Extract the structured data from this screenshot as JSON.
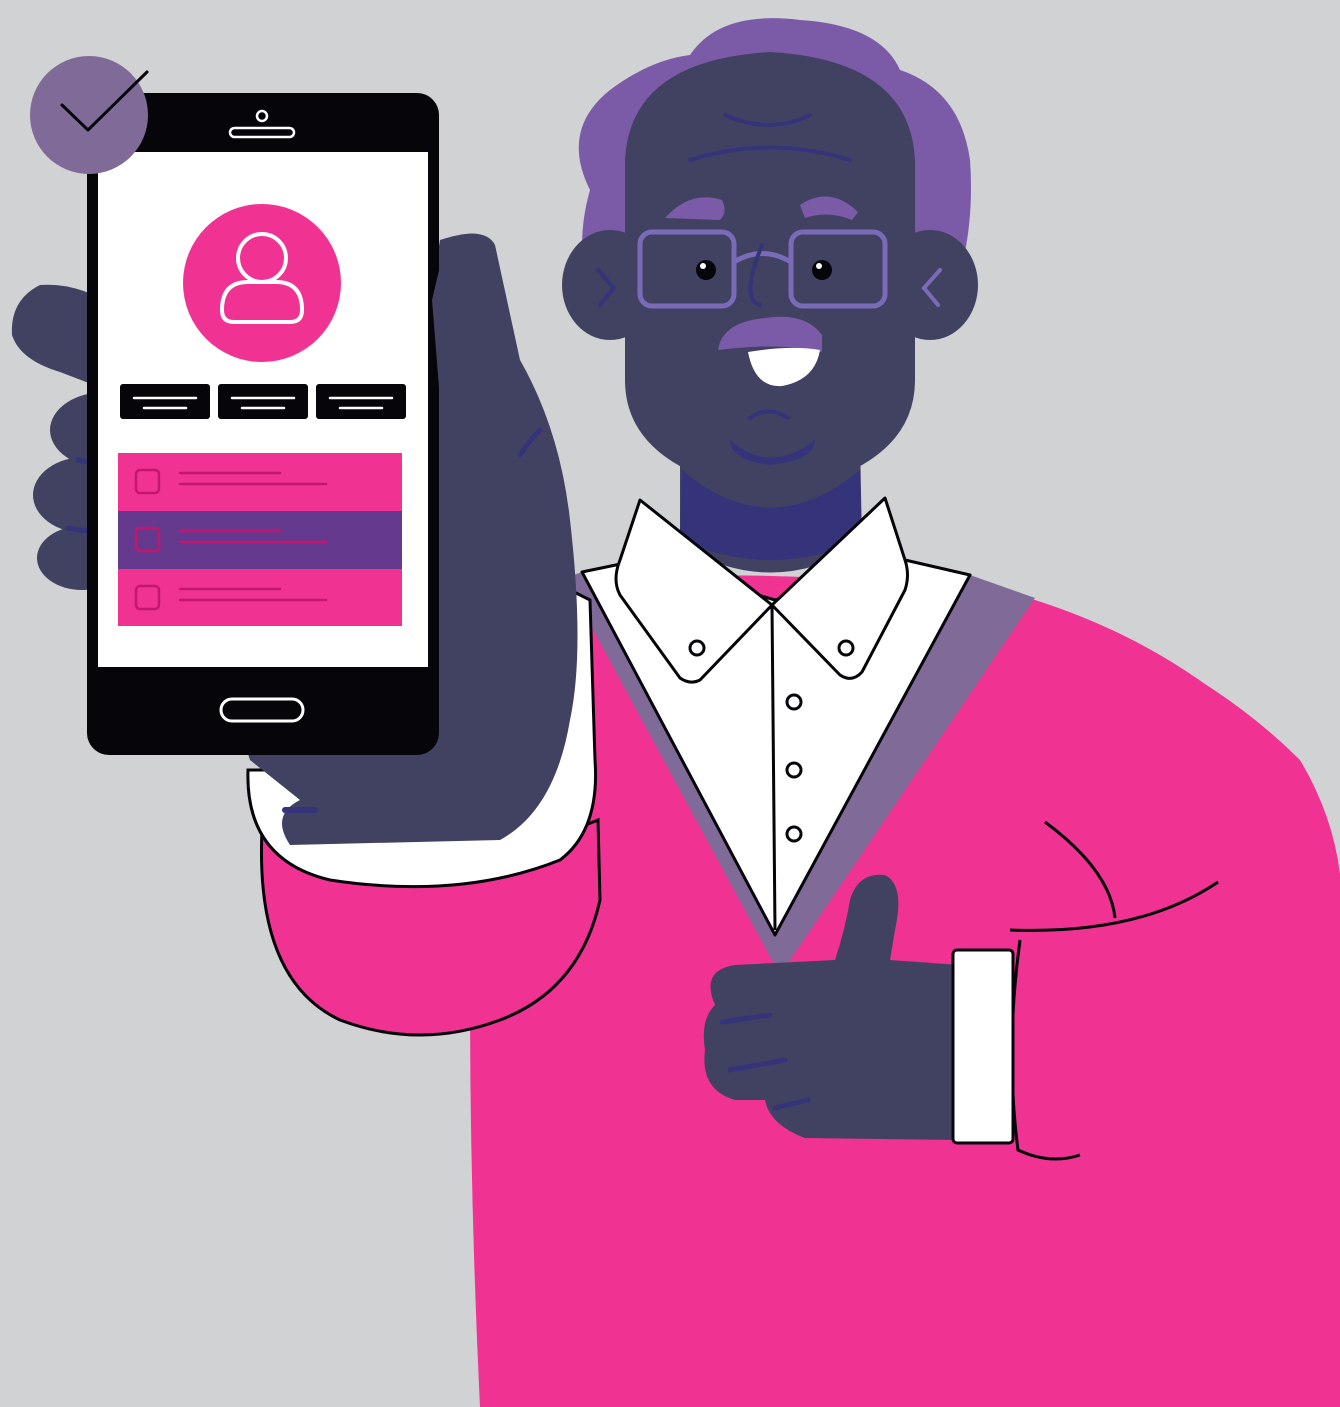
{
  "colors": {
    "background": "#d1d2d4",
    "skin": "#414262",
    "skin_shadow": "#35337a",
    "hair": "#7b5ba8",
    "sweater": "#f03393",
    "sweater_trim": "#806b98",
    "shirt": "#ffffff",
    "outline": "#05050a",
    "glasses": "#7a6bb8",
    "phone_body": "#05050a",
    "phone_screen": "#ffffff",
    "accent_pink": "#f03393",
    "accent_purple": "#653a8e",
    "check_badge": "#806b98"
  },
  "icons": {
    "check_badge": "check-icon",
    "avatar": "user-icon",
    "home_button": "home-button-icon",
    "speaker": "speaker-icon"
  },
  "phone_ui": {
    "tabs_count": 3,
    "list_rows": [
      {
        "state": "unchecked",
        "color": "#f03393"
      },
      {
        "state": "selected",
        "color": "#653a8e"
      },
      {
        "state": "unchecked",
        "color": "#f03393"
      }
    ]
  }
}
